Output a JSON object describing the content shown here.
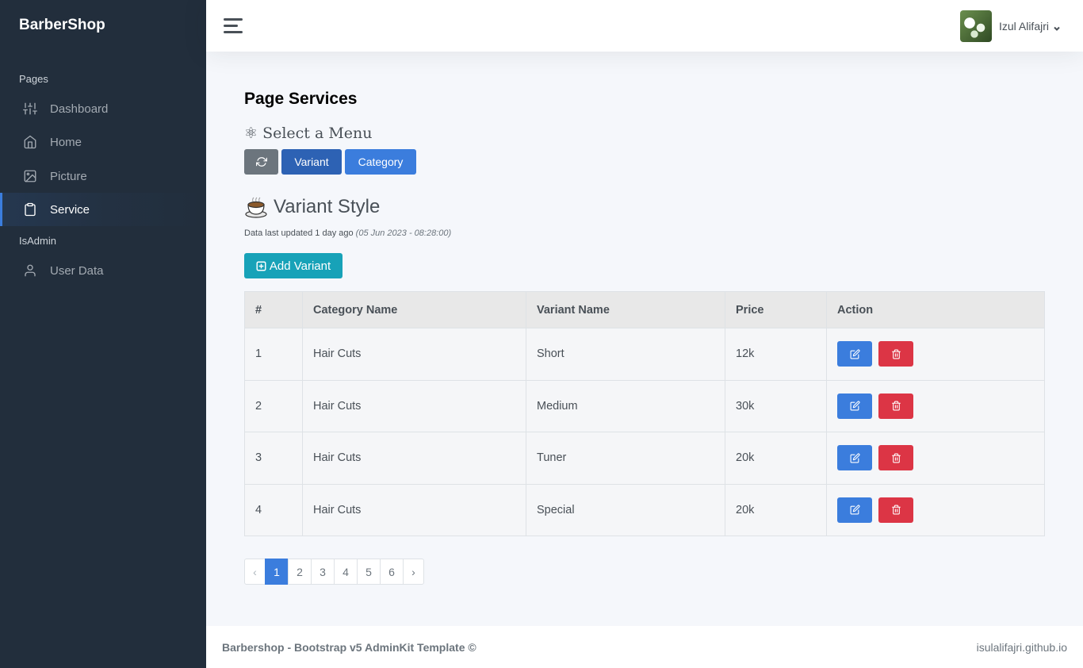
{
  "sidebar": {
    "brand": "BarberShop",
    "header_pages": "Pages",
    "header_admin": "IsAdmin",
    "items": [
      {
        "label": "Dashboard",
        "icon": "sliders-icon"
      },
      {
        "label": "Home",
        "icon": "home-icon"
      },
      {
        "label": "Picture",
        "icon": "image-icon"
      },
      {
        "label": "Service",
        "icon": "clipboard-icon",
        "active": true
      },
      {
        "label": "User Data",
        "icon": "user-icon"
      }
    ]
  },
  "topbar": {
    "user_name": "Izul Alifajri"
  },
  "main": {
    "title_bold": "Page",
    "title_rest": "Services",
    "select_menu": "⚛ Select a Menu",
    "buttons": {
      "variant": "Variant",
      "category": "Category"
    },
    "section_title": "Variant Style",
    "updated_text": "Data last updated 1 day ago",
    "updated_date": "(05 Jun 2023 - 08:28:00)",
    "add_button": "Add Variant",
    "table": {
      "headers": [
        "#",
        "Category Name",
        "Variant Name",
        "Price",
        "Action"
      ],
      "rows": [
        {
          "no": "1",
          "category": "Hair Cuts",
          "variant": "Short",
          "price": "12k"
        },
        {
          "no": "2",
          "category": "Hair Cuts",
          "variant": "Medium",
          "price": "30k"
        },
        {
          "no": "3",
          "category": "Hair Cuts",
          "variant": "Tuner",
          "price": "20k"
        },
        {
          "no": "4",
          "category": "Hair Cuts",
          "variant": "Special",
          "price": "20k"
        }
      ]
    },
    "pagination": {
      "prev": "‹",
      "pages": [
        "1",
        "2",
        "3",
        "4",
        "5",
        "6"
      ],
      "active": "1",
      "next": "›"
    }
  },
  "footer": {
    "left": "Barbershop - Bootstrap v5 AdminKit Template ©",
    "right": "isulalifajri.github.io"
  },
  "colors": {
    "sidebar_bg": "#222e3c",
    "primary": "#3b7ddd",
    "danger": "#dc3545",
    "info": "#17a2b8",
    "secondary": "#6c757d"
  }
}
